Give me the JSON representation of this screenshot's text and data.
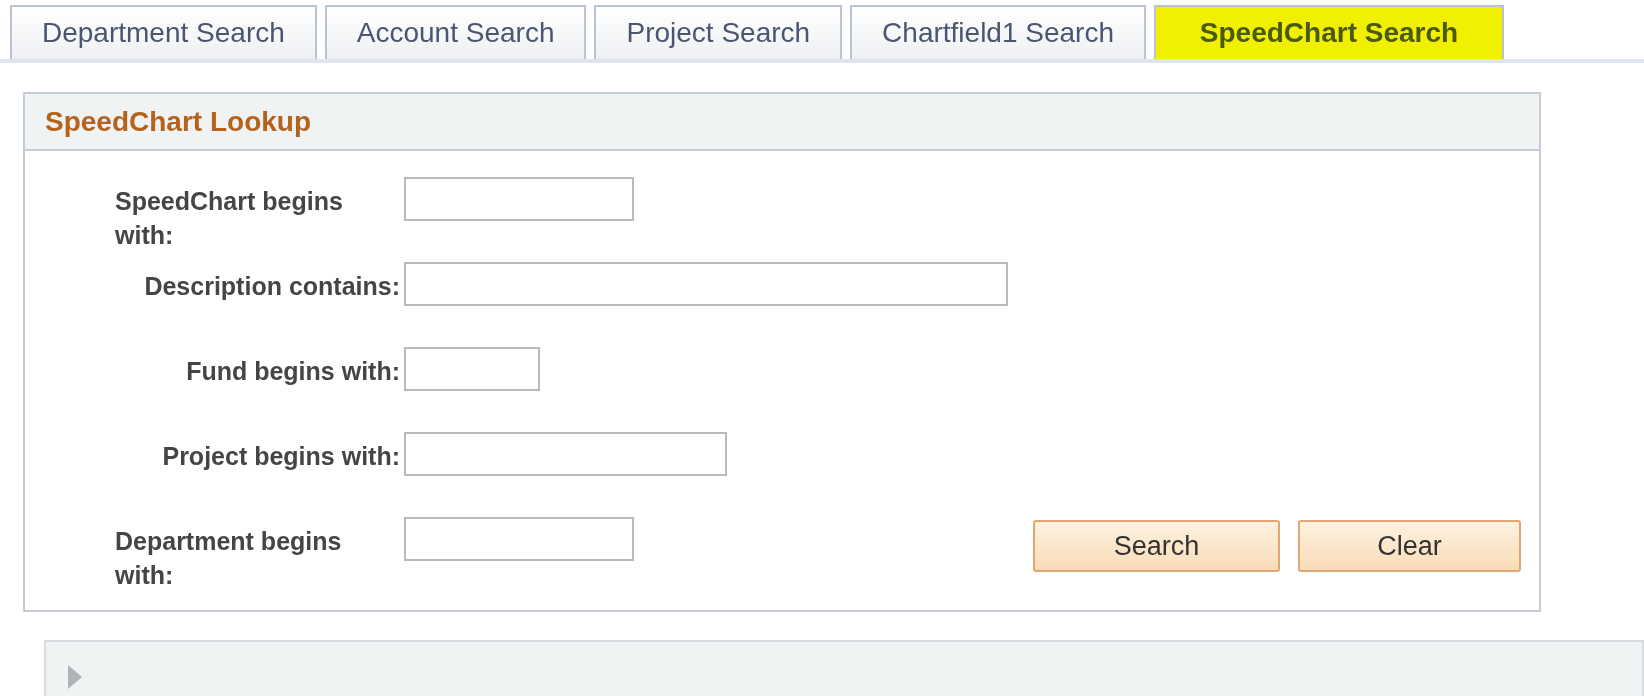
{
  "tabs": [
    {
      "label": "Department Search",
      "selected": false
    },
    {
      "label": "Account Search",
      "selected": false
    },
    {
      "label": "Project Search",
      "selected": false
    },
    {
      "label": "Chartfield1 Search",
      "selected": false
    },
    {
      "label": "SpeedChart Search",
      "selected": true
    }
  ],
  "panel": {
    "title": "SpeedChart Lookup",
    "fields": [
      {
        "label": "SpeedChart begins with:"
      },
      {
        "label": "Description contains:"
      },
      {
        "label": "Fund begins with:"
      },
      {
        "label": "Project begins with:"
      },
      {
        "label": "Department begins with:"
      }
    ],
    "buttons": [
      "Search",
      "Clear"
    ]
  },
  "collapsed_section": {
    "expanded": false
  }
}
